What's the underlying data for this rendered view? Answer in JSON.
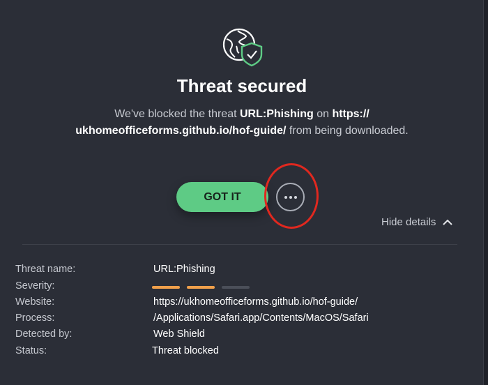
{
  "header": {
    "title": "Threat secured",
    "message": {
      "prefix": "We've blocked the threat ",
      "threat": "URL:Phishing",
      "middle": " on ",
      "url_line1": "https://",
      "url_line2": "ukhomeofficeforms.github.io/hof-guide/",
      "suffix": " from being downloaded."
    }
  },
  "actions": {
    "got_it_label": "GOT IT",
    "more_icon": "more-horizontal-icon",
    "hide_details_label": "Hide details"
  },
  "details": [
    {
      "label": "Threat name:",
      "value": "URL:Phishing"
    },
    {
      "label": "Severity:",
      "value": ""
    },
    {
      "label": "Website:",
      "value": "https://ukhomeofficeforms.github.io/hof-guide/"
    },
    {
      "label": "Process:",
      "value": "/Applications/Safari.app/Contents/MacOS/Safari"
    },
    {
      "label": "Detected by:",
      "value": "Web Shield"
    },
    {
      "label": "Status:",
      "value": "Threat blocked"
    }
  ],
  "severity": {
    "level": 2,
    "max": 3,
    "active_color": "#f0a04b",
    "inactive_color": "#4b4f59"
  },
  "colors": {
    "accent_green": "#5ecb85",
    "annotation_red": "#e0281f",
    "background": "#2b2e37"
  }
}
